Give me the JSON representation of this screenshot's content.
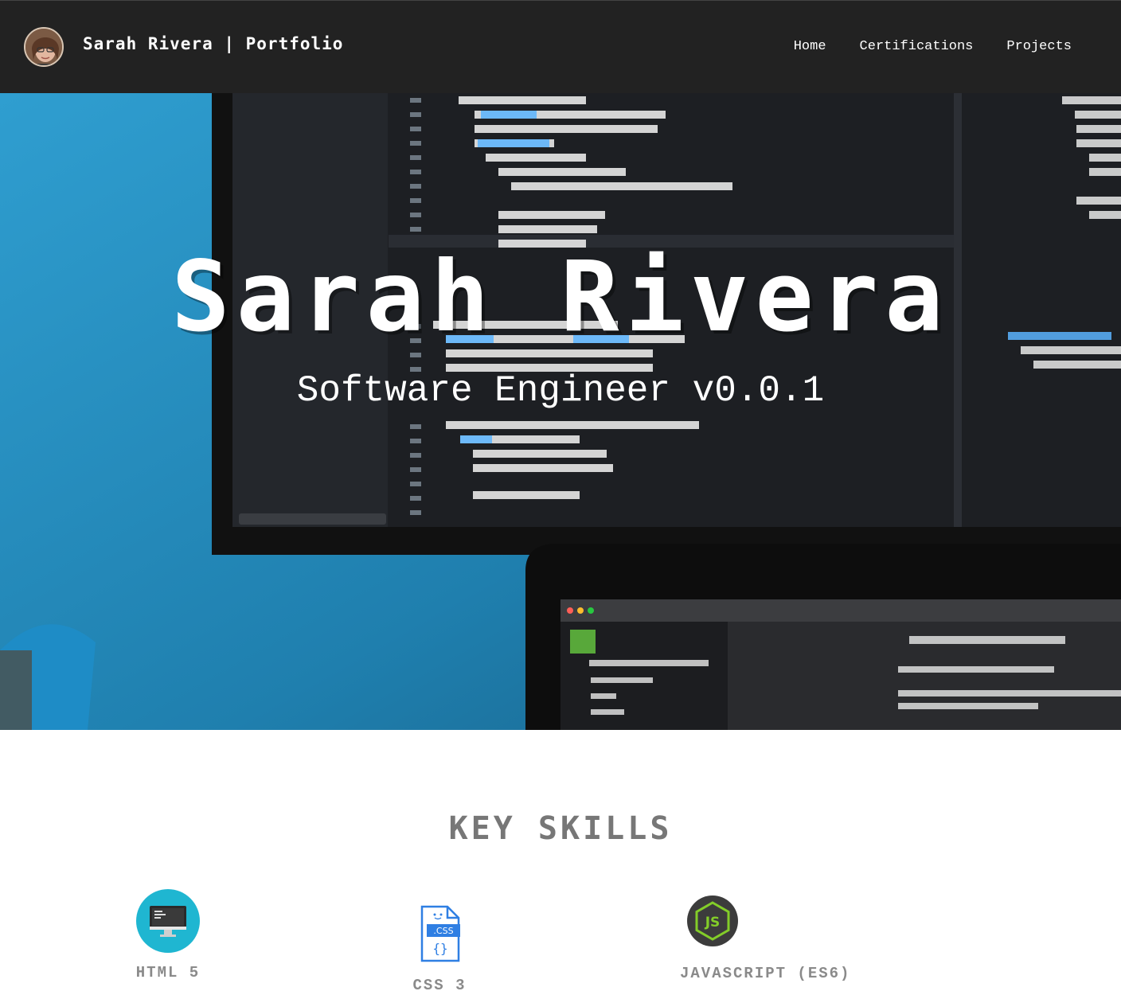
{
  "nav": {
    "brand": "Sarah Rivera | Portfolio",
    "links": [
      "Home",
      "Certifications",
      "Projects"
    ]
  },
  "hero": {
    "title": "Sarah Rivera",
    "subtitle": "Software Engineer v0.0.1"
  },
  "skills": {
    "heading": "KEY SKILLS",
    "items": [
      {
        "label": "HTML 5",
        "icon": "monitor-icon"
      },
      {
        "label": "CSS 3",
        "icon": "css-file-icon"
      },
      {
        "label": "JAVASCRIPT (ES6)",
        "icon": "nodejs-icon"
      }
    ]
  },
  "colors": {
    "nav_bg": "#222222",
    "hero_blue": "#2b8fc0",
    "heading_gray": "#777777",
    "label_gray": "#8a8a8a"
  }
}
